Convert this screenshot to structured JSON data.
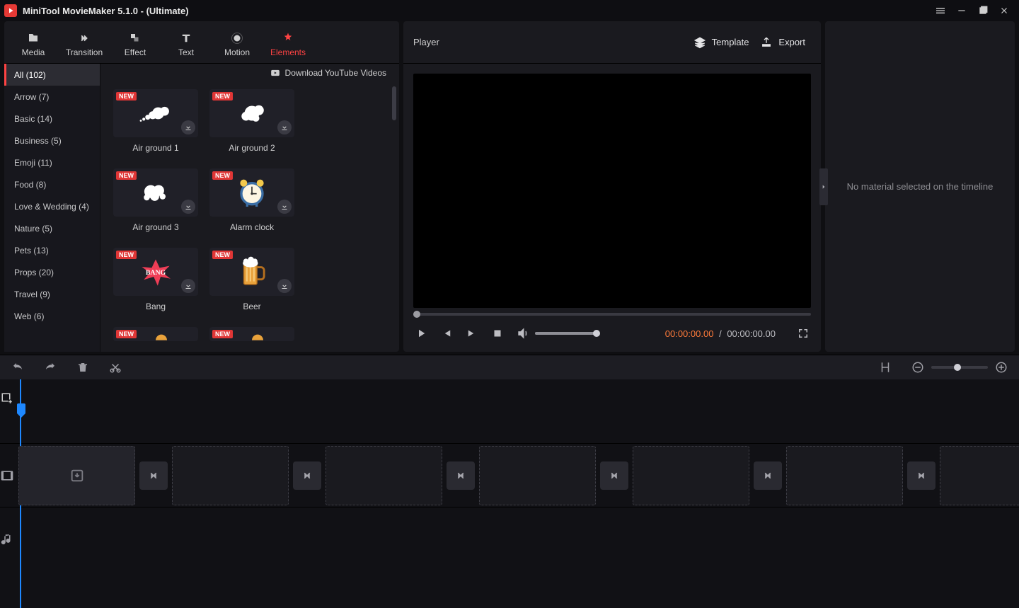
{
  "titlebar": {
    "title": "MiniTool MovieMaker 5.1.0 - (Ultimate)"
  },
  "top_tabs": [
    {
      "label": "Media"
    },
    {
      "label": "Transition"
    },
    {
      "label": "Effect"
    },
    {
      "label": "Text"
    },
    {
      "label": "Motion"
    },
    {
      "label": "Elements"
    }
  ],
  "active_top_tab": 5,
  "grid_header_link": "Download YouTube Videos",
  "categories": [
    "All (102)",
    "Arrow (7)",
    "Basic (14)",
    "Business (5)",
    "Emoji (11)",
    "Food (8)",
    "Love & Wedding (4)",
    "Nature (5)",
    "Pets (13)",
    "Props (20)",
    "Travel (9)",
    "Web (6)"
  ],
  "active_category": 0,
  "new_tag_text": "NEW",
  "elements_grid": [
    {
      "name": "Air ground 1",
      "kind": "smoke1"
    },
    {
      "name": "Air ground 2",
      "kind": "smoke2"
    },
    {
      "name": "Air ground 3",
      "kind": "smoke3"
    },
    {
      "name": "Alarm clock",
      "kind": "clock"
    },
    {
      "name": "Bang",
      "kind": "bang"
    },
    {
      "name": "Beer",
      "kind": "beer"
    },
    {
      "name": "",
      "kind": "partial"
    },
    {
      "name": "",
      "kind": "partial"
    }
  ],
  "player": {
    "label": "Player",
    "template_btn": "Template",
    "export_btn": "Export",
    "current_time": "00:00:00.00",
    "total_time": "00:00:00.00",
    "separator": "/"
  },
  "inspector": {
    "empty_message": "No material selected on the timeline"
  }
}
